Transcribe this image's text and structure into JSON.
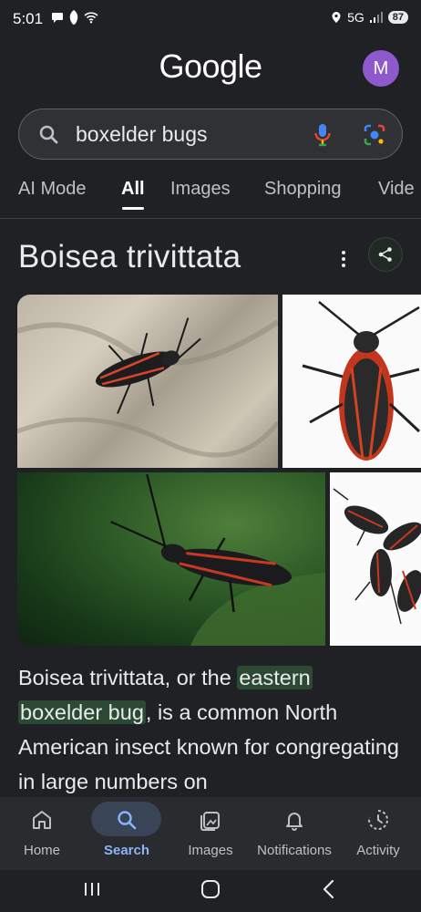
{
  "status_bar": {
    "time": "5:01",
    "network": "5G",
    "battery": "87",
    "icons": [
      "chat-icon",
      "alert-icon",
      "wifi-icon",
      "location-icon",
      "signal-icon"
    ]
  },
  "header": {
    "logo": "Google",
    "avatar_letter": "M",
    "avatar_color": "#8e59cc"
  },
  "search": {
    "query": "boxelder bugs"
  },
  "tabs": [
    {
      "label": "AI Mode"
    },
    {
      "label": "All",
      "active": true
    },
    {
      "label": "Images"
    },
    {
      "label": "Shopping"
    },
    {
      "label": "Vide"
    }
  ],
  "knowledge_panel": {
    "title": "Boisea trivittata",
    "description_parts": {
      "p1": "Boisea trivittata, or the ",
      "hl1": "eastern",
      "hl2": "boxelder bug",
      "p2": ", is a common North American insect known for congregating in large numbers on"
    }
  },
  "bottom_nav": [
    {
      "label": "Home",
      "icon": "home-icon"
    },
    {
      "label": "Search",
      "icon": "search-icon",
      "active": true
    },
    {
      "label": "Images",
      "icon": "images-icon"
    },
    {
      "label": "Notifications",
      "icon": "bell-icon"
    },
    {
      "label": "Activity",
      "icon": "activity-icon"
    }
  ],
  "colors": {
    "background": "#202124",
    "accent": "#8ab4f8",
    "highlight": "#2c4a33"
  }
}
